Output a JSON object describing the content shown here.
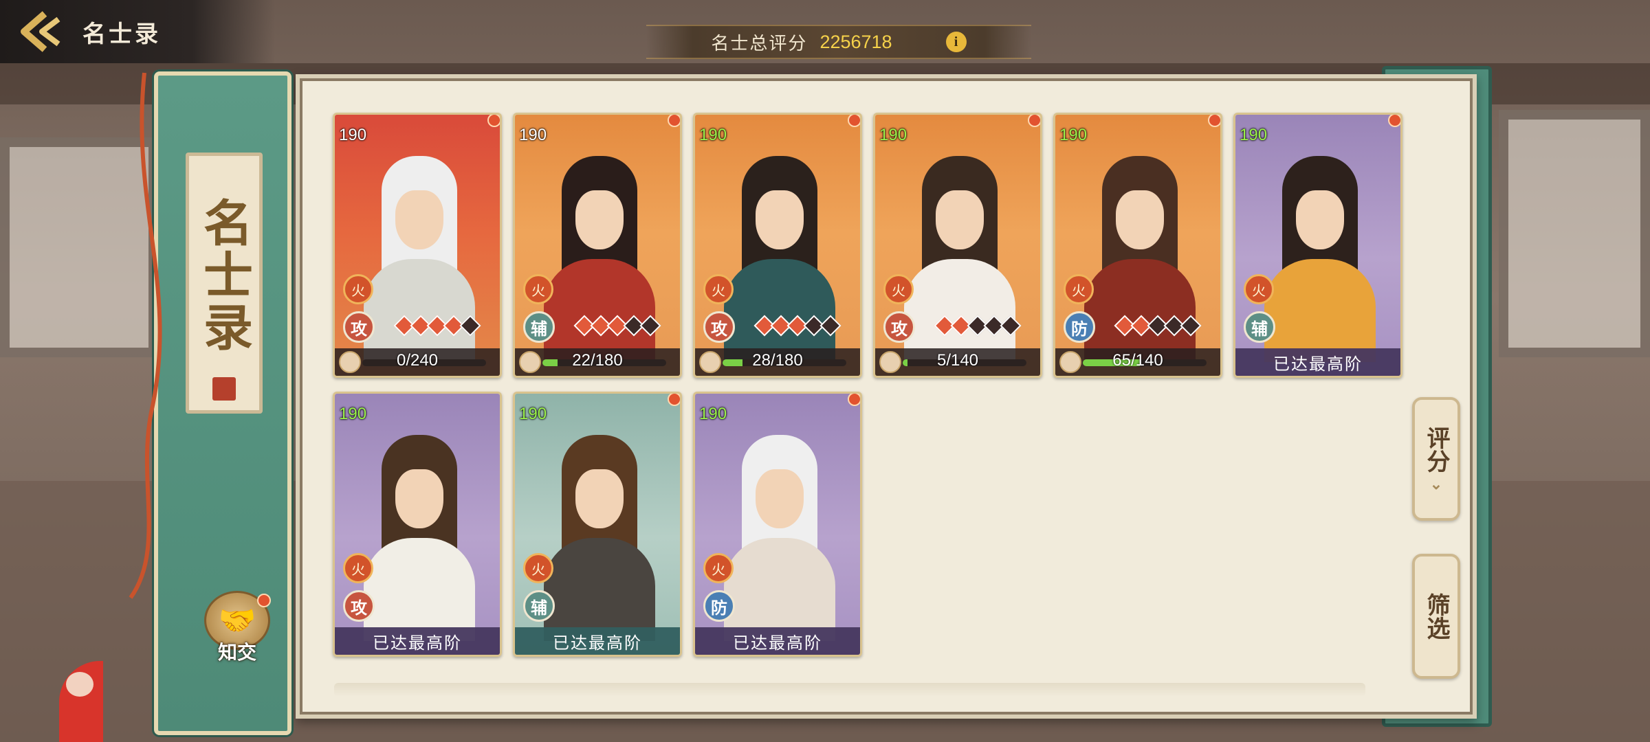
{
  "header": {
    "title": "名士录"
  },
  "score": {
    "label": "名士总评分",
    "value": "2256718"
  },
  "book": {
    "title": "名士录",
    "friend_label": "知交"
  },
  "side_buttons": {
    "sort_label": "评分",
    "filter_label": "筛选"
  },
  "colors": {
    "attack_role": "#c7553f",
    "support_role": "#5d8f86",
    "defense_role": "#4a7fb4",
    "progress_fill": "#7ad046",
    "score_value": "#f6d24a"
  },
  "cards": [
    {
      "level": "190",
      "level_color": "white",
      "element": "火",
      "role": "攻",
      "stars_filled": 4,
      "stars_total": 5,
      "footer": "0/240",
      "progress": 0.0,
      "max": false,
      "bg": "red",
      "alert": true
    },
    {
      "level": "190",
      "level_color": "white",
      "element": "火",
      "role": "辅",
      "stars_filled": 3,
      "stars_total": 5,
      "footer": "22/180",
      "progress": 0.12,
      "max": false,
      "bg": "orange",
      "alert": true
    },
    {
      "level": "190",
      "level_color": "green",
      "element": "火",
      "role": "攻",
      "stars_filled": 3,
      "stars_total": 5,
      "footer": "28/180",
      "progress": 0.16,
      "max": false,
      "bg": "orange",
      "alert": true
    },
    {
      "level": "190",
      "level_color": "green",
      "element": "火",
      "role": "攻",
      "stars_filled": 2,
      "stars_total": 5,
      "footer": "5/140",
      "progress": 0.04,
      "max": false,
      "bg": "orange",
      "alert": true
    },
    {
      "level": "190",
      "level_color": "green",
      "element": "火",
      "role": "防",
      "stars_filled": 2,
      "stars_total": 5,
      "footer": "65/140",
      "progress": 0.46,
      "max": false,
      "bg": "orange",
      "alert": true
    },
    {
      "level": "190",
      "level_color": "green",
      "element": "火",
      "role": "辅",
      "stars_filled": 0,
      "stars_total": 0,
      "footer": "已达最高阶",
      "progress": 1.0,
      "max": true,
      "bg": "purple",
      "alert": true
    },
    {
      "level": "190",
      "level_color": "green",
      "element": "火",
      "role": "攻",
      "stars_filled": 0,
      "stars_total": 0,
      "footer": "已达最高阶",
      "progress": 1.0,
      "max": true,
      "bg": "purple",
      "alert": false
    },
    {
      "level": "190",
      "level_color": "green",
      "element": "火",
      "role": "辅",
      "stars_filled": 0,
      "stars_total": 0,
      "footer": "已达最高阶",
      "progress": 1.0,
      "max": true,
      "bg": "teal",
      "alert": true
    },
    {
      "level": "190",
      "level_color": "green",
      "element": "火",
      "role": "防",
      "stars_filled": 0,
      "stars_total": 0,
      "footer": "已达最高阶",
      "progress": 1.0,
      "max": true,
      "bg": "purple",
      "alert": true
    }
  ]
}
